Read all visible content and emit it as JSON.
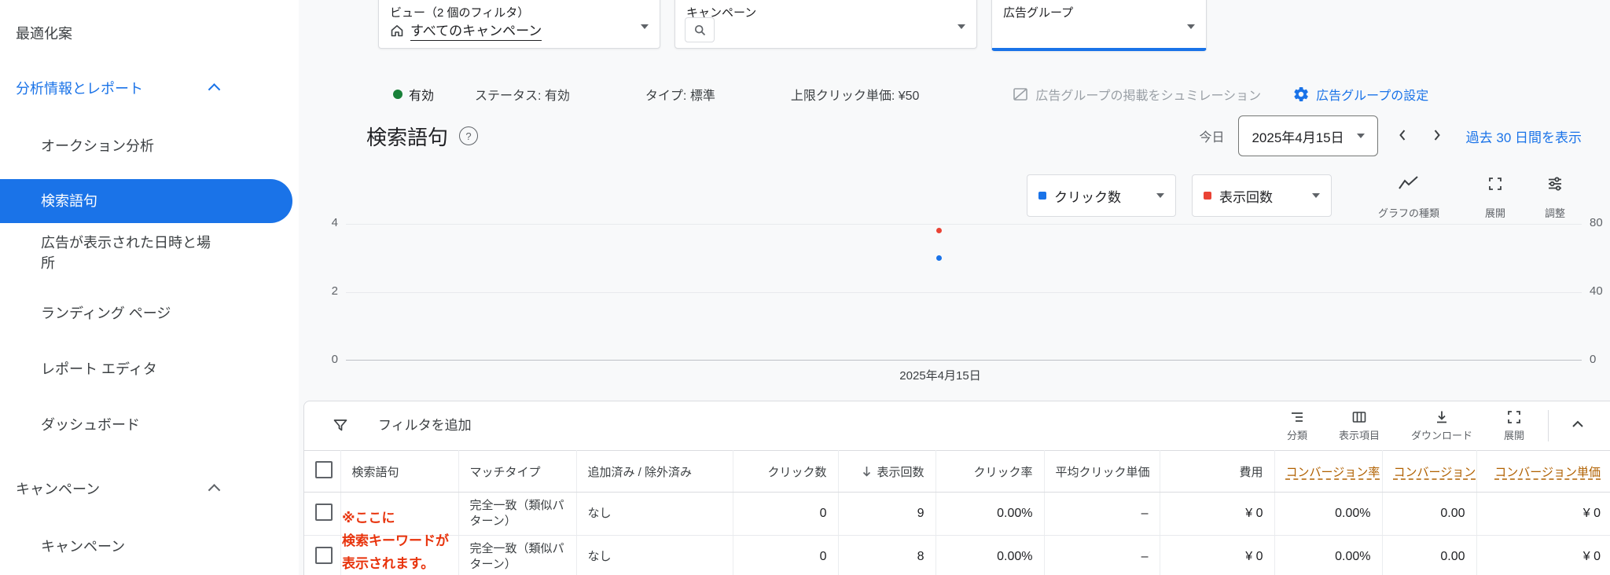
{
  "colors": {
    "accent": "#1a73e8",
    "series_clicks": "#1a73e8",
    "series_impressions": "#ea4335",
    "enabled_green": "#188038",
    "conversion_header": "#b06000",
    "annotation_red": "#e8330c"
  },
  "sidebar": {
    "top_item": "最適化案",
    "sections": [
      {
        "label": "分析情報とレポート",
        "items": [
          "オークション分析",
          "検索語句",
          "広告が表示された日時と場所",
          "ランディング ページ",
          "レポート エディタ",
          "ダッシュボード"
        ],
        "active_item": "検索語句"
      },
      {
        "label": "キャンペーン",
        "items": [
          "キャンペーン"
        ]
      }
    ]
  },
  "filter_bar": {
    "view": {
      "label": "ビュー（2 個のフィルタ）",
      "value": "すべてのキャンペーン"
    },
    "campaign": {
      "label": "キャンペーン"
    },
    "ad_group": {
      "label": "広告グループ"
    }
  },
  "status_bar": {
    "enabled_badge": "有効",
    "status": "ステータス: 有効",
    "type": "タイプ: 標準",
    "max_cpc": "上限クリック単価: ¥50",
    "simulate_link": "広告グループの掲載をシュミレーション",
    "settings_link": "広告グループの設定"
  },
  "page_header": {
    "title": "検索語句",
    "help_glyph": "?",
    "today_label": "今日",
    "date_value": "2025年4月15日",
    "range_link": "過去 30 日間を表示"
  },
  "chart_controls": {
    "metric1": "クリック数",
    "metric2": "表示回数",
    "chart_type_label": "グラフの種類",
    "expand_label": "展開",
    "adjust_label": "調整"
  },
  "chart_axes": {
    "left_ticks": [
      "4",
      "2",
      "0"
    ],
    "right_ticks": [
      "80",
      "40",
      "0"
    ],
    "x_tick": "2025年4月15日"
  },
  "chart_data": {
    "type": "line",
    "x": [
      "2025年4月15日"
    ],
    "series": [
      {
        "name": "クリック数",
        "color": "#1a73e8",
        "axis": "left",
        "values": [
          3
        ]
      },
      {
        "name": "表示回数",
        "color": "#ea4335",
        "axis": "right",
        "values": [
          76
        ]
      }
    ],
    "left_axis": {
      "ticks": [
        0,
        2,
        4
      ],
      "range": [
        0,
        4
      ]
    },
    "right_axis": {
      "ticks": [
        0,
        40,
        80
      ],
      "range": [
        0,
        80
      ]
    },
    "grid": true,
    "legend_position": "top-right"
  },
  "table": {
    "add_filter_label": "フィルタを追加",
    "tools": {
      "segment": "分類",
      "columns": "表示項目",
      "download": "ダウンロード",
      "expand": "展開"
    },
    "headers": [
      "検索語句",
      "マッチタイプ",
      "追加済み / 除外済み",
      "クリック数",
      "表示回数",
      "クリック率",
      "平均クリック単価",
      "費用",
      "コンバージョン率",
      "コンバージョン",
      "コンバージョン単価"
    ],
    "sorted_by": "表示回数",
    "rows": [
      {
        "term": "",
        "match_type": "完全一致（類似パターン）",
        "added_excluded": "なし",
        "clicks": "0",
        "impressions": "9",
        "ctr": "0.00%",
        "avg_cpc": "–",
        "cost": "¥ 0",
        "conv_rate": "0.00%",
        "conversions": "0.00",
        "cost_per_conv": "¥ 0"
      },
      {
        "term": "",
        "match_type": "完全一致（類似パターン）",
        "added_excluded": "なし",
        "clicks": "0",
        "impressions": "8",
        "ctr": "0.00%",
        "avg_cpc": "–",
        "cost": "¥ 0",
        "conv_rate": "0.00%",
        "conversions": "0.00",
        "cost_per_conv": "¥ 0"
      }
    ],
    "annotation": {
      "lines": [
        "※ここに",
        "検索キーワードが",
        "表示されます。"
      ],
      "color": "#e8330c"
    }
  }
}
